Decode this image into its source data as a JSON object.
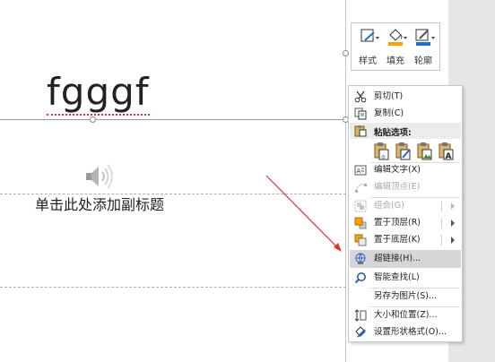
{
  "slide": {
    "title_text": "fgggf",
    "subtitle_text": "单击此处添加副标题"
  },
  "mini_toolbar": {
    "buttons": [
      {
        "label": "样式",
        "icon": "style-icon"
      },
      {
        "label": "填充",
        "icon": "fill-bucket-icon"
      },
      {
        "label": "轮廓",
        "icon": "outline-pen-icon"
      }
    ]
  },
  "context_menu": {
    "cut": "剪切(T)",
    "copy": "复制(C)",
    "paste_options": "粘贴选项:",
    "edit_text": "编辑文字(X)",
    "edit_points": "编辑顶点(E)",
    "group": "组合(G)",
    "bring_front": "置于顶层(R)",
    "send_back": "置于底层(K)",
    "hyperlink": "超链接(H)...",
    "smart_lookup": "智能查找(L)",
    "save_as_picture": "另存为图片(S)...",
    "size_position": "大小和位置(Z)...",
    "format_shape": "设置形状格式(O)..."
  },
  "colors": {
    "fill_accent": "#f4a300",
    "outline_accent": "#1f6fd1",
    "arrow": "#e03030",
    "highlight": "#d6d6d6"
  }
}
